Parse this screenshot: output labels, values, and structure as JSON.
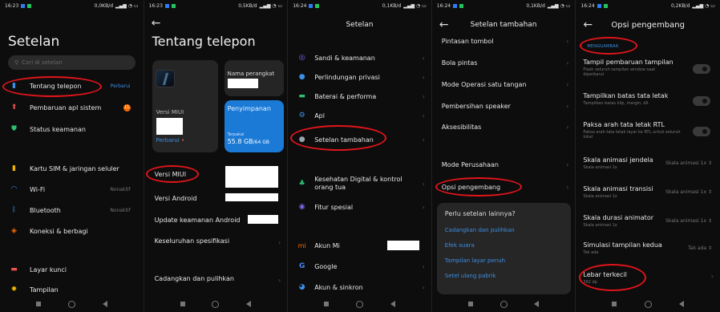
{
  "screens": [
    {
      "status": {
        "time": "16:23",
        "net": "0,0KB/d"
      },
      "title": "Setelan",
      "search_placeholder": "Cari di setelan",
      "items": [
        {
          "label": "Tentang telepon",
          "value": "Perbarui"
        },
        {
          "label": "Pembaruan apl sistem",
          "badge": "11"
        },
        {
          "label": "Status keamanan"
        },
        {
          "label": "Kartu SIM & jaringan seluler"
        },
        {
          "label": "Wi-Fi",
          "value": "Nonaktif"
        },
        {
          "label": "Bluetooth",
          "value": "Nonaktif"
        },
        {
          "label": "Koneksi & berbagi"
        },
        {
          "label": "Layar kunci"
        },
        {
          "label": "Tampilan"
        }
      ]
    },
    {
      "status": {
        "time": "16:23",
        "net": "0,5KB/d"
      },
      "title": "Tentang telepon",
      "miui_card": {
        "version_label": "Versi MIUI",
        "update": "Perbarui"
      },
      "device_card": {
        "label": "Nama perangkat"
      },
      "storage_card": {
        "label": "Penyimpanan",
        "used_label": "Terpakai",
        "used": "55.8 GB",
        "total": "/64 GB"
      },
      "rows": [
        "Versi MIUI",
        "Versi Android",
        "Update keamanan Android",
        "Keseluruhan spesifikasi",
        "Cadangkan dan pulihkan"
      ]
    },
    {
      "status": {
        "time": "16:24",
        "net": "0,1KB/d"
      },
      "title": "Setelan",
      "items": [
        {
          "label": "Sandi & keamanan"
        },
        {
          "label": "Perlindungan privasi"
        },
        {
          "label": "Baterai & performa"
        },
        {
          "label": "Apl"
        },
        {
          "label": "Setelan tambahan"
        },
        {
          "label": "Kesehatan Digital & kontrol orang tua"
        },
        {
          "label": "Fitur spesial"
        },
        {
          "label": "Akun Mi"
        },
        {
          "label": "Google"
        },
        {
          "label": "Akun & sinkron"
        }
      ]
    },
    {
      "status": {
        "time": "16:24",
        "net": "0,1KB/d"
      },
      "title": "Setelan tambahan",
      "items": [
        "Pintasan tombol",
        "Bola pintas",
        "Mode Operasi satu tangan",
        "Pembersihan speaker",
        "Aksesibilitas",
        "Mode Perusahaan",
        "Opsi pengembang"
      ],
      "more": {
        "title": "Perlu setelan lainnya?",
        "links": [
          "Cadangkan dan pulihkan",
          "Efek suara",
          "Tampilan layar penuh",
          "Setel ulang pabrik"
        ]
      }
    },
    {
      "status": {
        "time": "16:24",
        "net": "0,2KB/d"
      },
      "title": "Opsi pengembang",
      "section": "MENGGAMBAR",
      "items": [
        {
          "label": "Tampil pembaruan tampilan",
          "sub": "Flash seluruh tampilan window saat diperbarui"
        },
        {
          "label": "Tampilkan batas tata letak",
          "sub": "Tampilkan batas klip, margin, dll."
        },
        {
          "label": "Paksa arah tata letak RTL",
          "sub": "Paksa arah tata letak layar ke RTL untuk seluruh lokal"
        },
        {
          "label": "Skala animasi jendela",
          "sub": "Skala animasi 1x",
          "value": "Skala animasi 1x"
        },
        {
          "label": "Skala animasi transisi",
          "sub": "Skala animasi 1x",
          "value": "Skala animasi 1x"
        },
        {
          "label": "Skala durasi animator",
          "sub": "Skala animasi 1x",
          "value": "Skala animasi 1x"
        },
        {
          "label": "Simulasi tampilan kedua",
          "sub": "Tak ada",
          "value": "Tak ada"
        },
        {
          "label": "Lebar terkecil",
          "sub": "392 dp"
        }
      ]
    }
  ]
}
